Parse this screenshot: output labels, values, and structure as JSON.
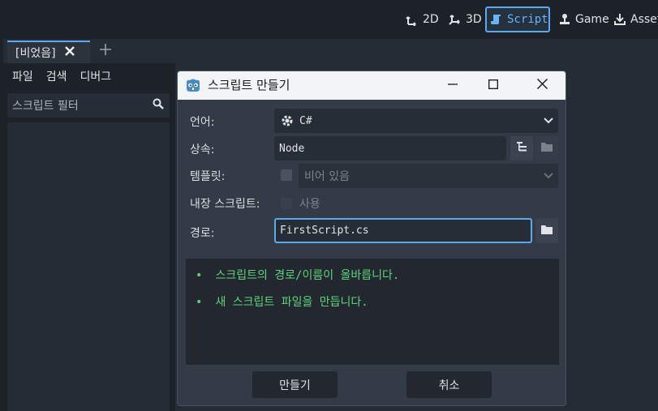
{
  "top_modes": [
    {
      "label": "2D",
      "icon": "2d-icon"
    },
    {
      "label": "3D",
      "icon": "3d-icon"
    },
    {
      "label": "Script",
      "icon": "script-icon",
      "active": true
    },
    {
      "label": "Game",
      "icon": "game-icon"
    },
    {
      "label": "Asset",
      "icon": "assetlib-icon"
    }
  ],
  "tabs": [
    {
      "label": "[비었음]"
    }
  ],
  "script_menu": [
    "파일",
    "검색",
    "디버그"
  ],
  "script_filter": {
    "placeholder": "스크립트 필터"
  },
  "dialog": {
    "title": "스크립트 만들기",
    "language_label": "언어:",
    "language_value": "C#",
    "inherits_label": "상속:",
    "inherits_value": "Node",
    "template_label": "템플릿:",
    "template_value": "비어 있음",
    "builtin_label": "내장 스크립트:",
    "builtin_option": "사용",
    "path_label": "경로:",
    "path_value": "FirstScript.cs",
    "messages": [
      "스크립트의 경로/이름이 올바릅니다.",
      "새 스크립트 파일을 만듭니다."
    ],
    "bullet": "•",
    "create_button": "만들기",
    "cancel_button": "취소"
  },
  "colors": {
    "accent": "#5ea8f0",
    "success_text": "#5fd37a"
  }
}
